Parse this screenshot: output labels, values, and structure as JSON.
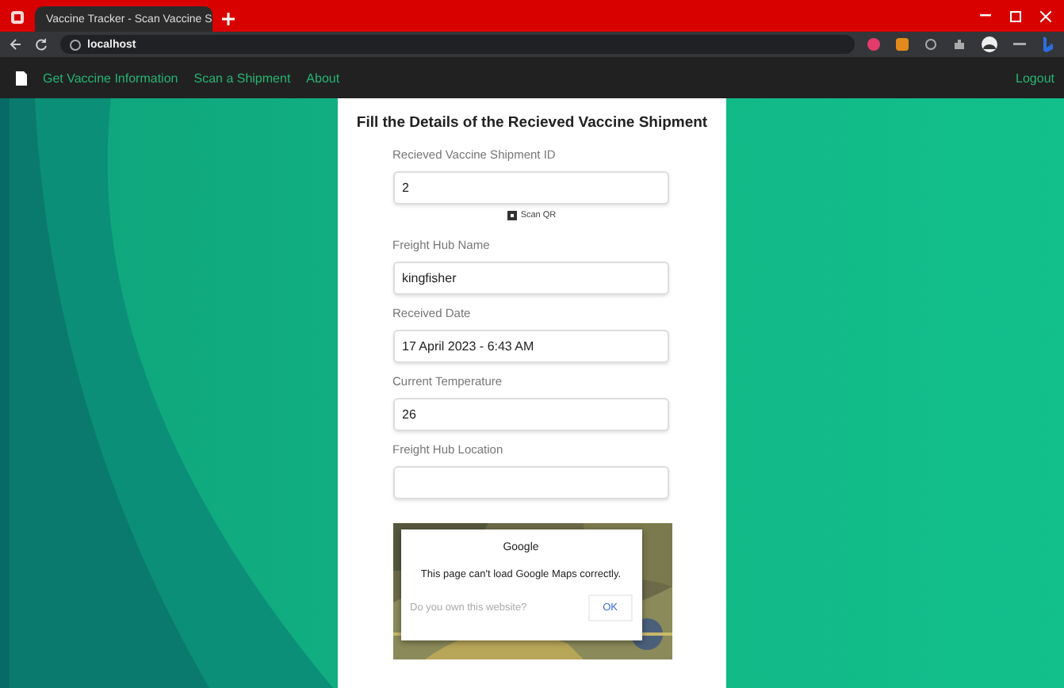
{
  "browser": {
    "tab_title": "Vaccine Tracker - Scan Vaccine S",
    "url": "localhost"
  },
  "nav": {
    "links": [
      "Get Vaccine Information",
      "Scan a Shipment",
      "About"
    ],
    "logout": "Logout"
  },
  "form": {
    "title": "Fill the Details of the Recieved Vaccine Shipment",
    "scan_button": "Scan QR",
    "fields": [
      {
        "label": "Recieved Vaccine Shipment ID",
        "value": "2"
      },
      {
        "label": "Freight Hub Name",
        "value": "kingfisher"
      },
      {
        "label": "Received Date",
        "value": "17 April 2023 - 6:43 AM"
      },
      {
        "label": "Current Temperature",
        "value": "26"
      },
      {
        "label": "Freight Hub Location"
      }
    ]
  },
  "map_dialog": {
    "title": "Google",
    "message": "This page can't load Google Maps correctly.",
    "link": "Do you own this website?",
    "button": "OK"
  }
}
